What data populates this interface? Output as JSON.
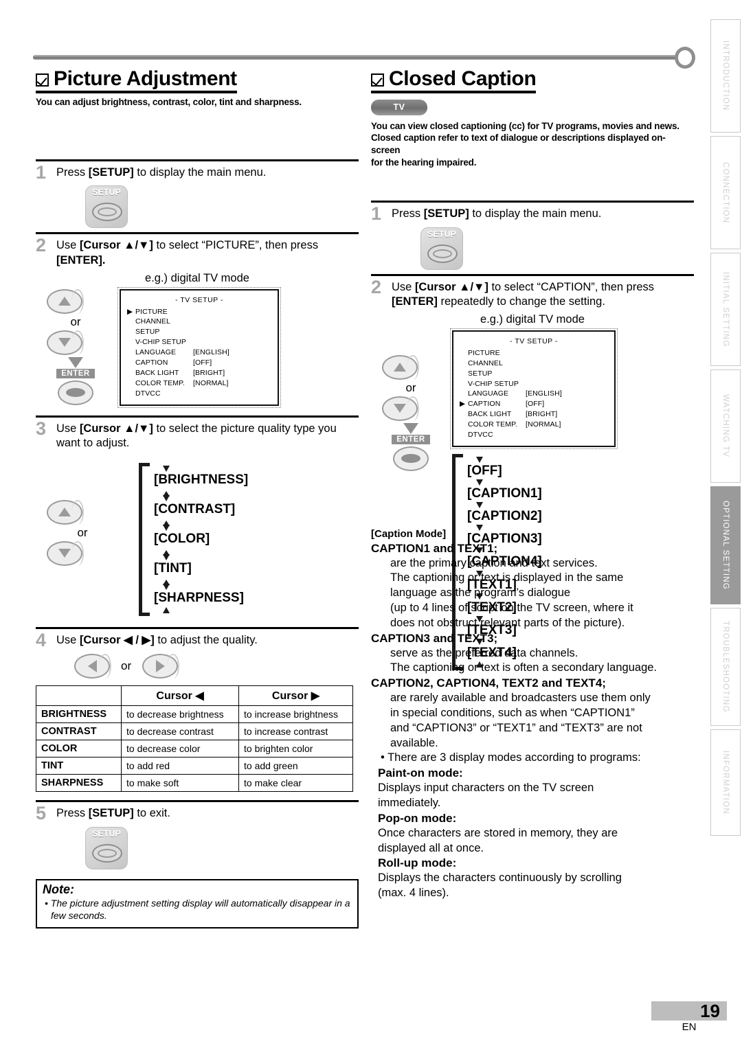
{
  "page": {
    "number": "19",
    "lang": "EN"
  },
  "side_tabs": [
    {
      "label": "INTRODUCTION",
      "active": false
    },
    {
      "label": "CONNECTION",
      "active": false
    },
    {
      "label": "INITIAL SETTING",
      "active": false
    },
    {
      "label": "WATCHING TV",
      "active": false
    },
    {
      "label": "OPTIONAL SETTING",
      "active": true
    },
    {
      "label": "TROUBLESHOOTING",
      "active": false
    },
    {
      "label": "INFORMATION",
      "active": false
    }
  ],
  "left": {
    "title": "Picture Adjustment",
    "subtitle": "You can adjust brightness, contrast, color, tint and sharpness.",
    "step1": {
      "num": "1",
      "text_before": "Press ",
      "key": "[SETUP]",
      "text_after": " to display the main menu.",
      "key_label": "SETUP"
    },
    "step2": {
      "num": "2",
      "line1_a": "Use ",
      "line1_cursor": "[Cursor ▲/▼]",
      "line1_b": " to select “PICTURE”, then press",
      "line2": "[ENTER].",
      "eg": "e.g.) digital TV mode",
      "or": "or",
      "enter_badge": "ENTER"
    },
    "osd": {
      "title": "-  TV SETUP  -",
      "rows": [
        {
          "mark": "▶",
          "name": "PICTURE",
          "value": ""
        },
        {
          "mark": "",
          "name": "CHANNEL SETUP",
          "value": ""
        },
        {
          "mark": "",
          "name": "V-CHIP  SETUP",
          "value": ""
        },
        {
          "mark": "",
          "name": "LANGUAGE",
          "value": "[ENGLISH]"
        },
        {
          "mark": "",
          "name": "CAPTION",
          "value": "[OFF]"
        },
        {
          "mark": "",
          "name": "BACK  LIGHT",
          "value": "[BRIGHT]"
        },
        {
          "mark": "",
          "name": "COLOR TEMP.",
          "value": "[NORMAL]"
        },
        {
          "mark": "",
          "name": "DTVCC",
          "value": ""
        }
      ]
    },
    "step3": {
      "num": "3",
      "line1_a": "Use ",
      "line1_cursor": "[Cursor ▲/▼]",
      "line1_b": " to select the picture quality type you",
      "line2": "want to adjust.",
      "or": "or",
      "cycle": [
        "[BRIGHTNESS]",
        "[CONTRAST]",
        "[COLOR]",
        "[TINT]",
        "[SHARPNESS]"
      ]
    },
    "step4": {
      "num": "4",
      "line1_a": "Use ",
      "line1_cursor": "[Cursor ◀ / ▶]",
      "line1_b": " to adjust the quality.",
      "or": "or"
    },
    "table": {
      "headers": [
        "",
        "Cursor ◀",
        "Cursor ▶"
      ],
      "rows": [
        {
          "name": "BRIGHTNESS",
          "left": "to decrease brightness",
          "right": "to increase brightness"
        },
        {
          "name": "CONTRAST",
          "left": "to decrease contrast",
          "right": "to increase contrast"
        },
        {
          "name": "COLOR",
          "left": "to decrease color",
          "right": "to brighten color"
        },
        {
          "name": "TINT",
          "left": "to add red",
          "right": "to add green"
        },
        {
          "name": "SHARPNESS",
          "left": "to make soft",
          "right": "to make clear"
        }
      ]
    },
    "step5": {
      "num": "5",
      "text_before": "Press ",
      "key": "[SETUP]",
      "text_after": " to exit.",
      "key_label": "SETUP"
    },
    "note": {
      "title": "Note:",
      "items": [
        "• The picture adjustment setting display will automatically disappear in a few seconds."
      ]
    }
  },
  "right": {
    "title": "Closed Caption",
    "badge": "TV",
    "subtitle_lines": [
      "You can view closed captioning (cc) for TV programs, movies and news.",
      "Closed caption refer to text of dialogue or descriptions displayed on-screen",
      "for the hearing impaired."
    ],
    "step1": {
      "num": "1",
      "text_before": "Press ",
      "key": "[SETUP]",
      "text_after": " to display the main menu.",
      "key_label": "SETUP"
    },
    "step2": {
      "num": "2",
      "line1_a": "Use ",
      "line1_cursor": "[Cursor ▲/▼]",
      "line1_b": " to select “CAPTION”, then press",
      "line2_key": "[ENTER]",
      "line2_rest": " repeatedly to change the setting.",
      "eg": "e.g.) digital TV mode",
      "or": "or",
      "enter_badge": "ENTER"
    },
    "osd": {
      "title": "-  TV SETUP  -",
      "rows": [
        {
          "mark": "",
          "name": "PICTURE",
          "value": ""
        },
        {
          "mark": "",
          "name": "CHANNEL SETUP",
          "value": ""
        },
        {
          "mark": "",
          "name": "V-CHIP  SETUP",
          "value": ""
        },
        {
          "mark": "",
          "name": "LANGUAGE",
          "value": "[ENGLISH]"
        },
        {
          "mark": "▶",
          "name": "CAPTION",
          "value": "[OFF]"
        },
        {
          "mark": "",
          "name": "BACK  LIGHT",
          "value": "[BRIGHT]"
        },
        {
          "mark": "",
          "name": "COLOR TEMP.",
          "value": "[NORMAL]"
        },
        {
          "mark": "",
          "name": "DTVCC",
          "value": ""
        }
      ]
    },
    "cycle": [
      "[OFF]",
      "[CAPTION1]",
      "[CAPTION2]",
      "[CAPTION3]",
      "[CAPTION4]",
      "[TEXT1]",
      "[TEXT2]",
      "[TEXT3]",
      "[TEXT4]"
    ],
    "caption_mode_label": "[Caption Mode]",
    "blocks": [
      {
        "heading": "CAPTION1 and TEXT1;",
        "lines": [
          "are the primary caption and text services.",
          "The captioning or text is displayed in the same",
          "language as the program’s dialogue",
          "(up to 4 lines of script on the TV screen, where it",
          "does not obstruct relevant parts of the picture)."
        ]
      },
      {
        "heading": "CAPTION3 and TEXT3;",
        "lines": [
          "serve as the preferred data channels.",
          "The captioning or text is often a secondary language."
        ]
      },
      {
        "heading": "CAPTION2, CAPTION4, TEXT2 and TEXT4;",
        "lines": [
          "are rarely available and broadcasters use them only",
          "in special conditions, such as when “CAPTION1”",
          "and “CAPTION3” or “TEXT1” and “TEXT3” are not",
          "available."
        ]
      }
    ],
    "display_modes_intro": "•   There are 3 display modes according to programs:",
    "modes": [
      {
        "heading": "Paint-on mode:",
        "lines": [
          "Displays input characters on the TV screen",
          "immediately."
        ]
      },
      {
        "heading": "Pop-on mode:",
        "lines": [
          "Once characters are stored in memory, they are",
          "displayed all at once."
        ]
      },
      {
        "heading": "Roll-up mode:",
        "lines": [
          "Displays the characters continuously by scrolling",
          "(max. 4 lines)."
        ]
      }
    ]
  }
}
